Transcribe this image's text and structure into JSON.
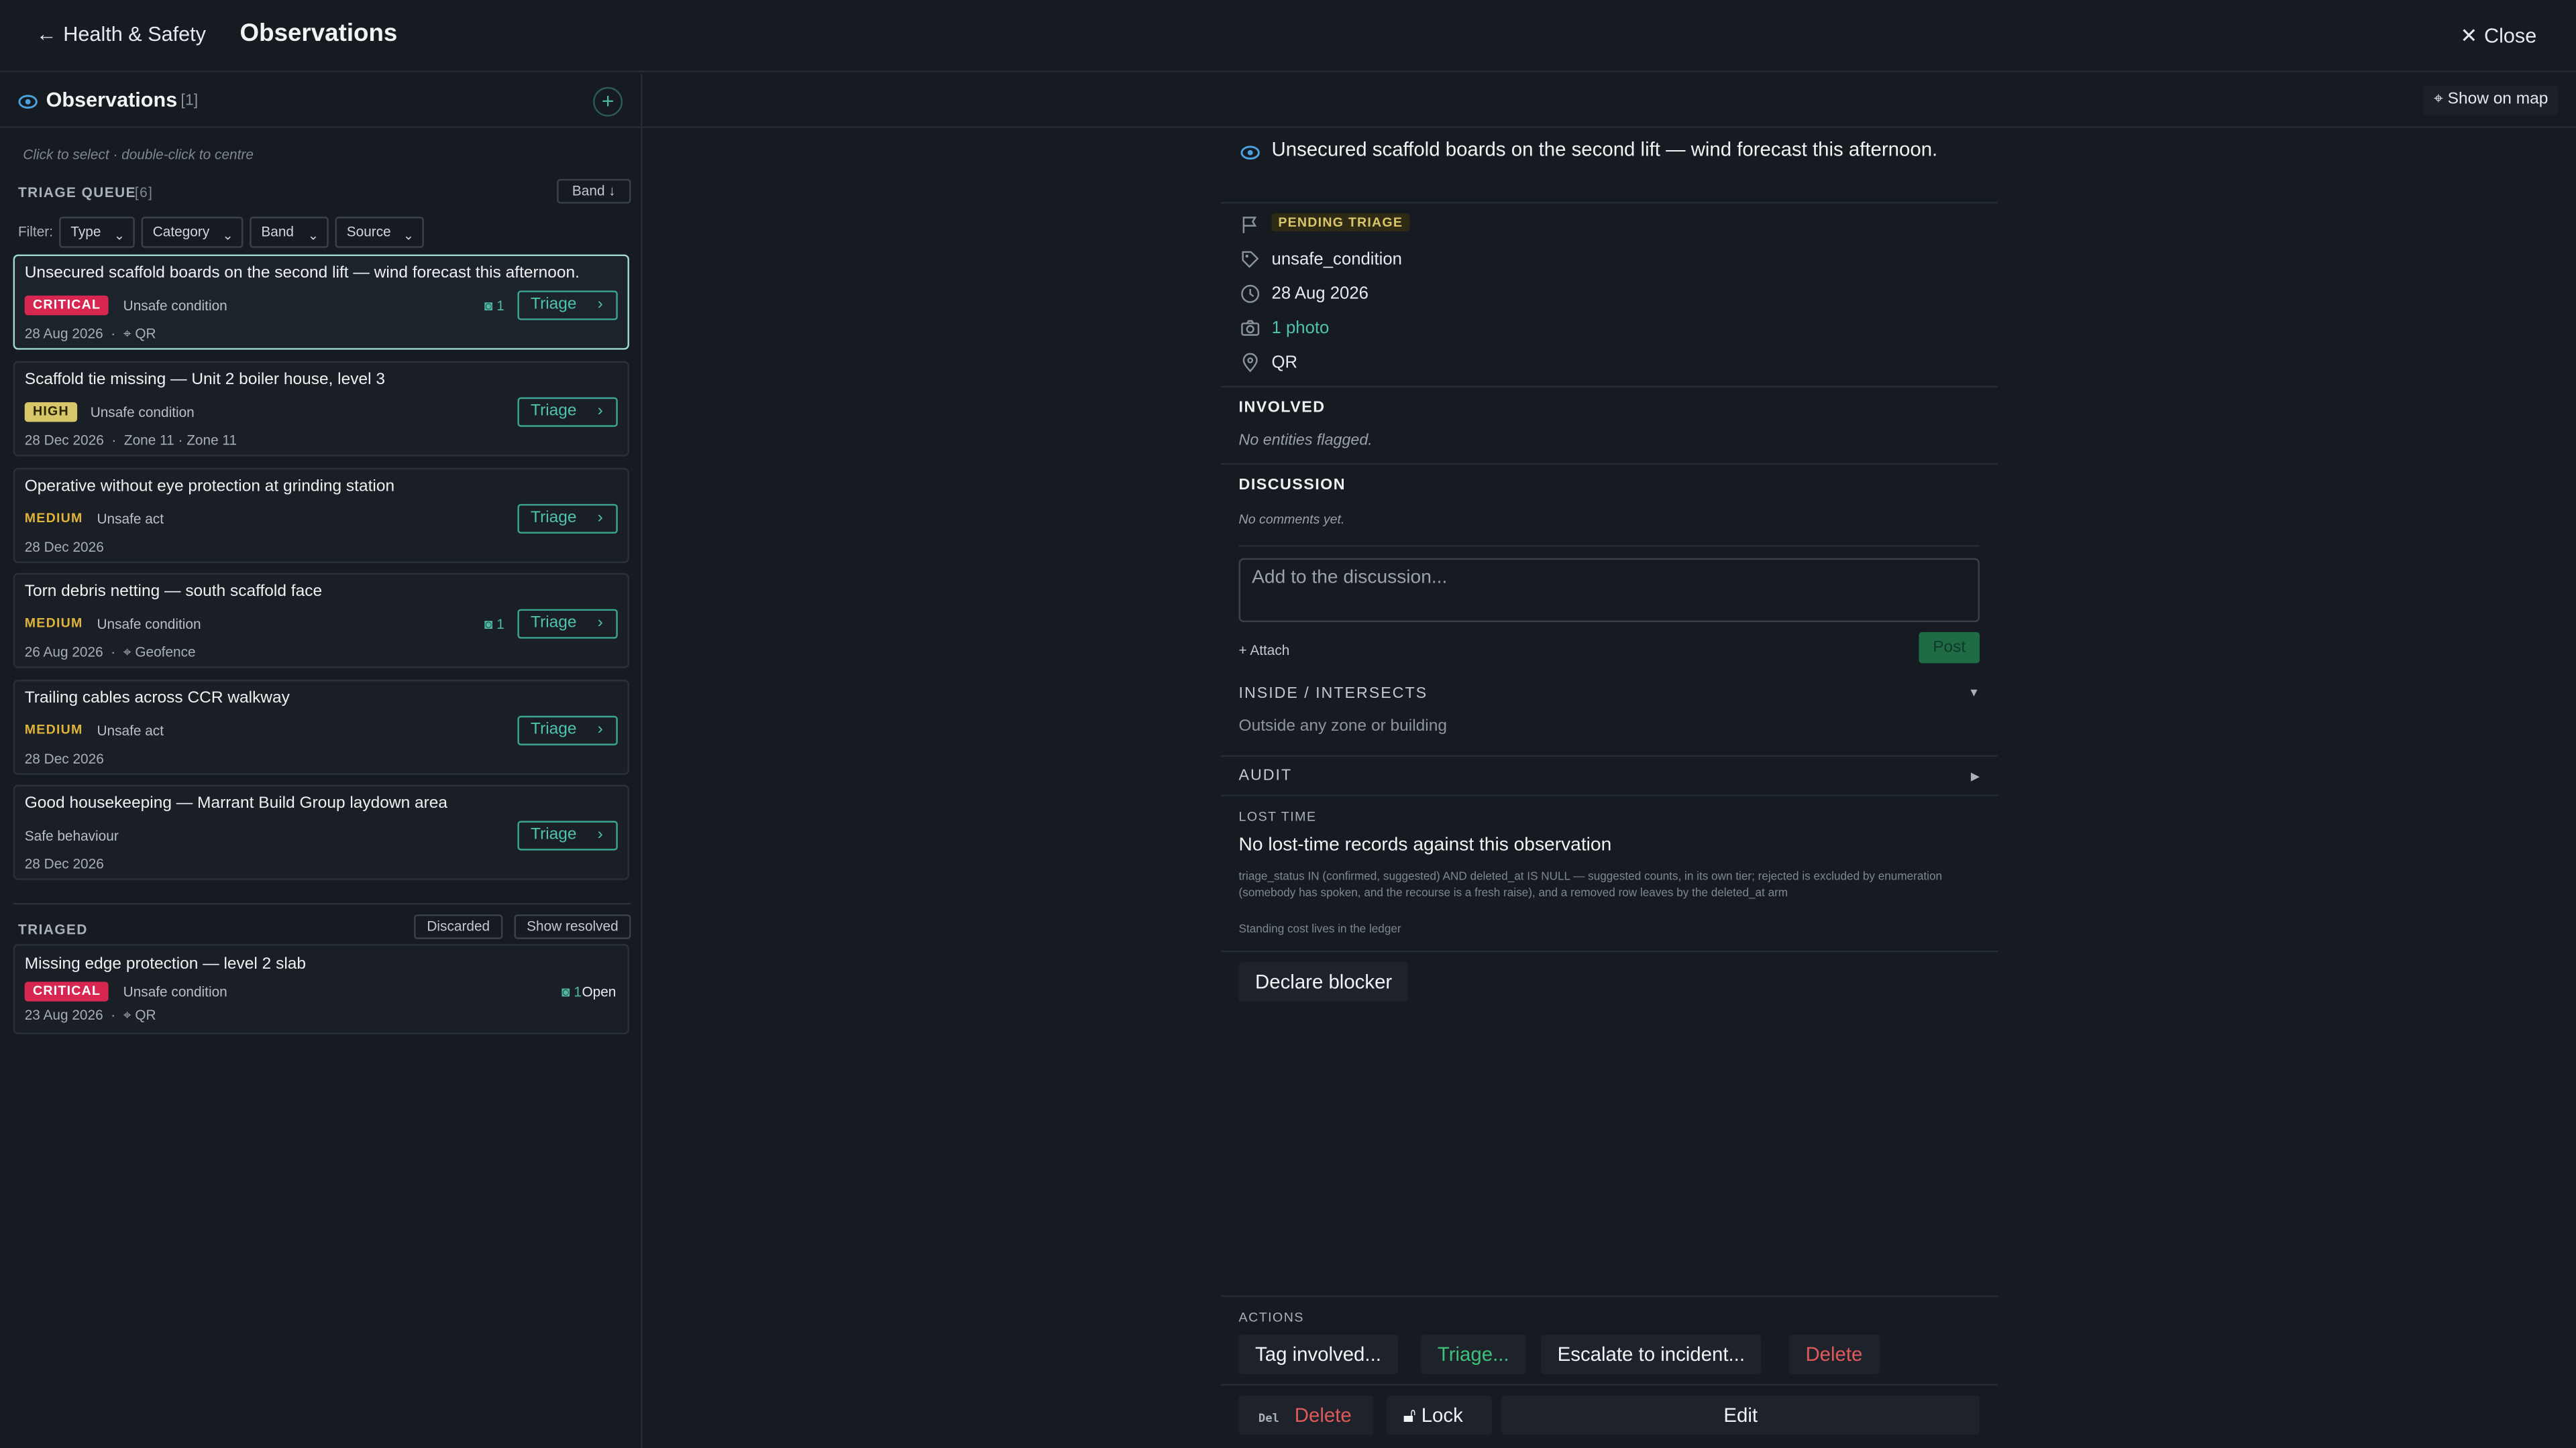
{
  "header": {
    "back_label": "Health & Safety",
    "title": "Observations",
    "close_label": "Close"
  },
  "left_panel": {
    "title": "Observations",
    "count": "[1]",
    "hint": "Click to select · double-click to centre",
    "queue_label": "TRIAGE QUEUE",
    "queue_count": "[6]",
    "sort_label": "Band ↓",
    "filter_label": "Filter:",
    "filters": [
      "Type",
      "Category",
      "Band",
      "Source"
    ],
    "queue": [
      {
        "title": "Unsecured scaffold boards on the second lift — wind forecast this afternoon.",
        "band": "CRITICAL",
        "band_class": "critical",
        "category": "Unsafe condition",
        "date": "28 Aug 2026",
        "location": "QR",
        "photos": "1",
        "action": "Triage"
      },
      {
        "title": "Scaffold tie missing — Unit 2 boiler house, level 3",
        "band": "HIGH",
        "band_class": "high",
        "category": "Unsafe condition",
        "date": "28 Dec 2026",
        "zone": "Zone 11 · Zone 11",
        "action": "Triage"
      },
      {
        "title": "Operative without eye protection at grinding station",
        "band": "MEDIUM",
        "band_class": "medium",
        "category": "Unsafe act",
        "date": "28 Dec 2026",
        "action": "Triage"
      },
      {
        "title": "Torn debris netting — south scaffold face",
        "band": "MEDIUM",
        "band_class": "medium",
        "category": "Unsafe condition",
        "date": "26 Aug 2026",
        "location": "Geofence",
        "photos": "1",
        "action": "Triage"
      },
      {
        "title": "Trailing cables across CCR walkway",
        "band": "MEDIUM",
        "band_class": "medium",
        "category": "Unsafe act",
        "date": "28 Dec 2026",
        "action": "Triage"
      },
      {
        "title": "Good housekeeping — Marrant Build Group laydown area",
        "band": "",
        "band_class": "none",
        "category": "Safe behaviour",
        "date": "28 Dec 2026",
        "action": "Triage"
      }
    ],
    "triaged_label": "TRIAGED",
    "discarded_label": "Discarded",
    "show_resolved_label": "Show resolved",
    "triaged": [
      {
        "title": "Missing edge protection — level 2 slab",
        "band": "CRITICAL",
        "band_class": "critical",
        "category": "Unsafe condition",
        "date": "23 Aug 2026",
        "location": "QR",
        "photos": "1",
        "status": "Open"
      }
    ]
  },
  "right_panel": {
    "show_map_label": "Show on map",
    "title": "Unsecured scaffold boards on the second lift — wind forecast this afternoon.",
    "status": "PENDING TRIAGE",
    "category": "unsafe_condition",
    "date": "28 Aug 2026",
    "photos": "1 photo",
    "source": "QR",
    "involved_label": "INVOLVED",
    "involved_empty": "No entities flagged.",
    "discussion_label": "DISCUSSION",
    "discussion_empty": "No comments yet.",
    "discussion_placeholder": "Add to the discussion...",
    "attach_label": "+ Attach",
    "post_label": "Post",
    "inside_label": "INSIDE / INTERSECTS",
    "inside_value": "Outside any zone or building",
    "audit_label": "AUDIT",
    "lost_time_label": "LOST TIME",
    "lost_time_main": "No lost-time records against this observation",
    "lost_time_note": "triage_status IN (confirmed, suggested) AND deleted_at IS NULL — suggested counts, in its own tier; rejected is excluded by enumeration (somebody has spoken, and the recourse is a fresh raise), and a removed row leaves by the deleted_at arm",
    "lost_time_note2": "Standing cost lives in the ledger",
    "declare_blocker_label": "Declare blocker",
    "actions_label": "ACTIONS",
    "tag_involved_label": "Tag involved...",
    "triage_label": "Triage...",
    "escalate_label": "Escalate to incident...",
    "delete_label": "Delete",
    "del_key": "Del",
    "bottom_delete_label": "Delete",
    "lock_label": "Lock",
    "edit_label": "Edit"
  },
  "colors": {
    "accent": "#4fc2ad",
    "critical": "#d7264f",
    "high": "#d8c66a",
    "medium": "#e0b43a",
    "danger": "#e05a5a",
    "success": "#3fc07a"
  }
}
